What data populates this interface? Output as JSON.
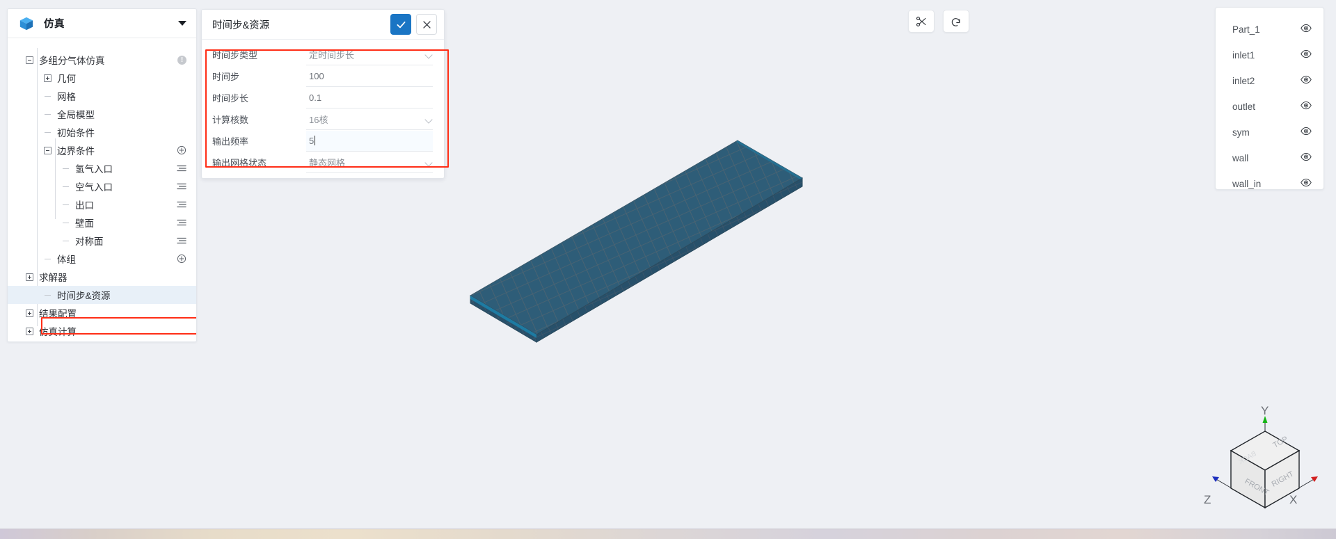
{
  "sidebar": {
    "logo_icon": "cube-logo-icon",
    "title": "仿真",
    "collapse_icon": "chevron-down-icon",
    "tree": [
      {
        "label": "多组分气体仿真",
        "toggle": "minus",
        "depth": 0,
        "action": "info"
      },
      {
        "label": "几何",
        "toggle": "plus",
        "depth": 1,
        "action": "none"
      },
      {
        "label": "网格",
        "toggle": "leaf",
        "depth": 1,
        "action": "none"
      },
      {
        "label": "全局模型",
        "toggle": "leaf",
        "depth": 1,
        "action": "none"
      },
      {
        "label": "初始条件",
        "toggle": "leaf",
        "depth": 1,
        "action": "none"
      },
      {
        "label": "边界条件",
        "toggle": "minus",
        "depth": 1,
        "action": "add"
      },
      {
        "label": "氢气入口",
        "toggle": "leaf",
        "depth": 2,
        "action": "list"
      },
      {
        "label": "空气入口",
        "toggle": "leaf",
        "depth": 2,
        "action": "list"
      },
      {
        "label": "出口",
        "toggle": "leaf",
        "depth": 2,
        "action": "list"
      },
      {
        "label": "壁面",
        "toggle": "leaf",
        "depth": 2,
        "action": "list"
      },
      {
        "label": "对称面",
        "toggle": "leaf",
        "depth": 2,
        "action": "list"
      },
      {
        "label": "体组",
        "toggle": "leaf",
        "depth": 1,
        "action": "add"
      },
      {
        "label": "求解器",
        "toggle": "plus",
        "depth": 0,
        "action": "none"
      },
      {
        "label": "时间步&资源",
        "toggle": "leaf",
        "depth": 1,
        "action": "none",
        "selected": true
      },
      {
        "label": "结果配置",
        "toggle": "plus",
        "depth": 0,
        "action": "none"
      },
      {
        "label": "仿真计算",
        "toggle": "plus",
        "depth": 0,
        "action": "none"
      }
    ]
  },
  "dialog": {
    "title": "时间步&资源",
    "confirm_icon": "check-icon",
    "cancel_icon": "close-icon",
    "fields": [
      {
        "label": "时间步类型",
        "value": "定时间步长",
        "control": "select",
        "focused": false
      },
      {
        "label": "时间步",
        "value": "100",
        "control": "input",
        "focused": false
      },
      {
        "label": "时间步长",
        "value": "0.1",
        "control": "input",
        "focused": false
      },
      {
        "label": "计算核数",
        "value": "16核",
        "control": "select",
        "focused": false
      },
      {
        "label": "输出频率",
        "value": "5",
        "control": "input",
        "focused": true
      },
      {
        "label": "输出网格状态",
        "value": "静态网格",
        "control": "select",
        "focused": false
      }
    ],
    "highlight_color": "#ff2d16"
  },
  "viewport_tools": [
    {
      "icon": "scissors-icon",
      "name": "section-cut-tool"
    },
    {
      "icon": "rotate-icon",
      "name": "reset-view-tool"
    }
  ],
  "parts_panel": {
    "items": [
      {
        "name": "Part_1",
        "visibility_icon": "eye-icon"
      },
      {
        "name": "inlet1",
        "visibility_icon": "eye-icon"
      },
      {
        "name": "inlet2",
        "visibility_icon": "eye-icon"
      },
      {
        "name": "outlet",
        "visibility_icon": "eye-icon"
      },
      {
        "name": "sym",
        "visibility_icon": "eye-icon"
      },
      {
        "name": "wall",
        "visibility_icon": "eye-icon"
      },
      {
        "name": "wall_in",
        "visibility_icon": "eye-icon"
      }
    ]
  },
  "view_cube": {
    "faces": {
      "top": "TOP",
      "front": "FRONT",
      "right": "RIGHT",
      "back": "BACK"
    },
    "axes": {
      "x": "X",
      "y": "Y",
      "z": "Z"
    },
    "axis_colors": {
      "x": "#d21f1f",
      "y": "#13b413",
      "z": "#1c2fbe"
    }
  },
  "model": {
    "surface_color": "#2e5d78",
    "mesh_line_color": "#54656f",
    "background_color": "#eef0f4"
  }
}
